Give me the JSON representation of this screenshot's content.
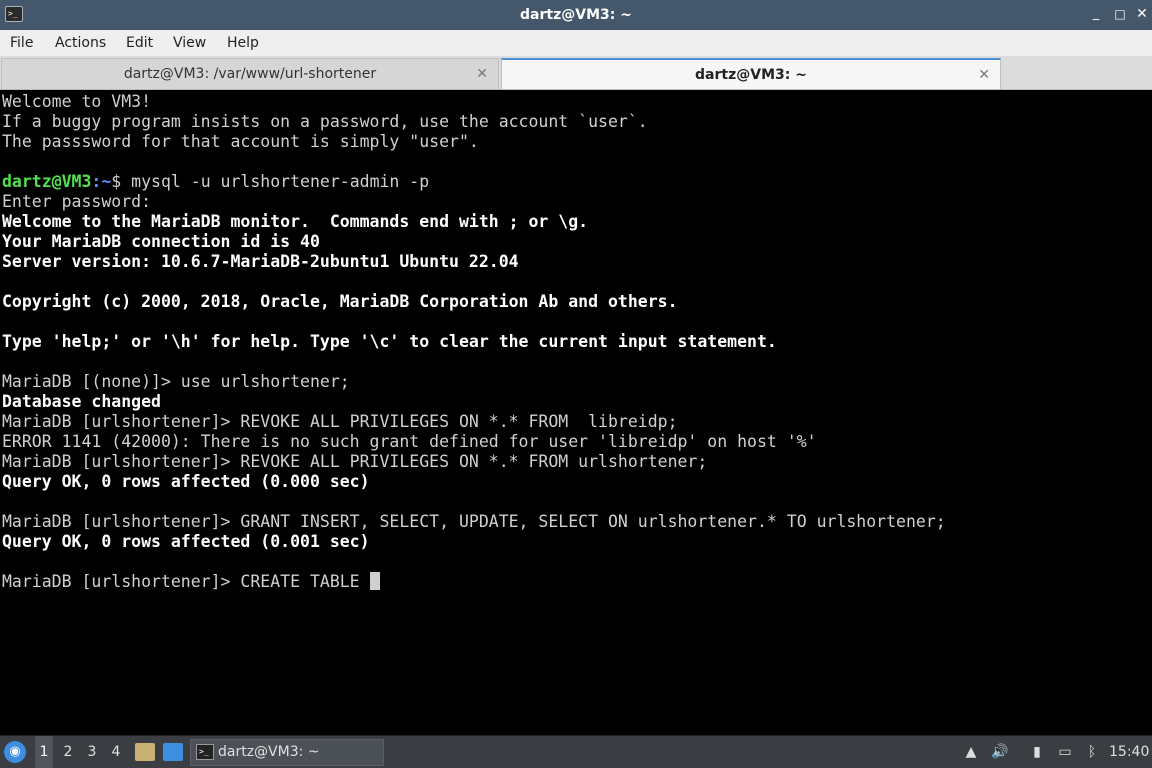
{
  "window": {
    "title": "dartz@VM3: ~",
    "minimize": "_",
    "maximize": "□",
    "close": "✕"
  },
  "menu": [
    "File",
    "Actions",
    "Edit",
    "View",
    "Help"
  ],
  "tabs": [
    {
      "label": "dartz@VM3: /var/www/url-shortener",
      "close": "✕"
    },
    {
      "label": "dartz@VM3: ~",
      "close": "✕"
    }
  ],
  "terminal": {
    "welcome": [
      "Welcome to VM3!",
      "If a buggy program insists on a password, use the account `user`.",
      "The passsword for that account is simply \"user\"."
    ],
    "prompt_user": "dartz@VM3",
    "prompt_path": ":~",
    "prompt_sym": "$ ",
    "command": "mysql -u urlshortener-admin -p",
    "enter_password": "Enter password:",
    "mariadb_banner": [
      "Welcome to the MariaDB monitor.  Commands end with ; or \\g.",
      "Your MariaDB connection id is 40",
      "Server version: 10.6.7-MariaDB-2ubuntu1 Ubuntu 22.04"
    ],
    "copyright": "Copyright (c) 2000, 2018, Oracle, MariaDB Corporation Ab and others.",
    "help_hint": "Type 'help;' or '\\h' for help. Type '\\c' to clear the current input statement.",
    "session": [
      {
        "text": "MariaDB [(none)]> use urlshortener;",
        "bold": false
      },
      {
        "text": "Database changed",
        "bold": true
      },
      {
        "text": "MariaDB [urlshortener]> REVOKE ALL PRIVILEGES ON *.* FROM  libreidp;",
        "bold": false
      },
      {
        "text": "ERROR 1141 (42000): There is no such grant defined for user 'libreidp' on host '%'",
        "bold": false
      },
      {
        "text": "MariaDB [urlshortener]> REVOKE ALL PRIVILEGES ON *.* FROM urlshortener;",
        "bold": false
      },
      {
        "text": "Query OK, 0 rows affected (0.000 sec)",
        "bold": true
      },
      {
        "text": "MariaDB [urlshortener]> GRANT INSERT, SELECT, UPDATE, SELECT ON urlshortener.* TO urlshortener;",
        "bold": false
      },
      {
        "text": "Query OK, 0 rows affected (0.001 sec)",
        "bold": true
      }
    ],
    "current_input": "MariaDB [urlshortener]> CREATE TABLE "
  },
  "taskbar": {
    "workspaces": [
      "1",
      "2",
      "3",
      "4"
    ],
    "active_workspace": "1",
    "task_label": "dartz@VM3: ~",
    "clock": "15:40"
  },
  "icons": {
    "app": "terminal-icon",
    "start": "lubuntu-start-icon",
    "files": "file-manager-icon",
    "desktop": "show-desktop-icon",
    "volume": "volume-icon",
    "clipboard": "clipboard-icon",
    "network": "network-icon",
    "bluetooth": "bluetooth-icon"
  },
  "colors": {
    "titlebar": "#45576b",
    "prompt_user": "#4fe34f",
    "prompt_path": "#5b8dff",
    "terminal_bg": "#000000",
    "taskbar": "#3a3d42"
  }
}
